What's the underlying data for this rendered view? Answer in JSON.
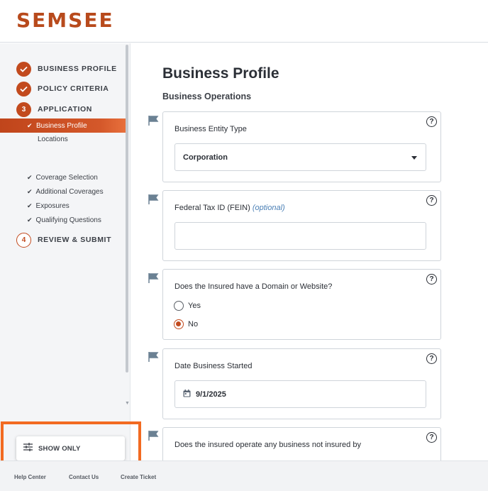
{
  "brand": {
    "logo_text": "SEMSEE",
    "accent": "#c24a1e",
    "highlight": "#f26a21"
  },
  "sidebar": {
    "steps": [
      {
        "label": "BUSINESS PROFILE",
        "status": "complete",
        "icon": "check-icon"
      },
      {
        "label": "POLICY CRITERIA",
        "status": "complete",
        "icon": "check-icon"
      },
      {
        "number": "3",
        "label": "APPLICATION",
        "status": "current"
      },
      {
        "number": "4",
        "label": "REVIEW & SUBMIT",
        "status": "pending"
      }
    ],
    "application_items": [
      {
        "label": "Business Profile",
        "active": true
      },
      {
        "label": "Locations"
      },
      {
        "label": "Coverage Selection",
        "checked": true
      },
      {
        "label": "Additional Coverages",
        "checked": true
      },
      {
        "label": "Exposures",
        "checked": true
      },
      {
        "label": "Qualifying Questions",
        "checked": true
      }
    ],
    "show_only_label": "SHOW ONLY"
  },
  "footer": {
    "links": [
      "Help Center",
      "Contact Us",
      "Create Ticket"
    ]
  },
  "main": {
    "title": "Business Profile",
    "section": "Business Operations",
    "questions": [
      {
        "label": "Business Entity Type",
        "type": "select",
        "value": "Corporation"
      },
      {
        "label": "Federal Tax ID (FEIN)",
        "optional_note": "(optional)",
        "type": "text",
        "value": ""
      },
      {
        "label": "Does the Insured have a Domain or Website?",
        "type": "radio",
        "options": [
          "Yes",
          "No"
        ],
        "selected": "No"
      },
      {
        "label": "Date Business Started",
        "type": "date",
        "value": "9/1/2025"
      },
      {
        "label": "Does the insured operate any business not insured by",
        "type": "radio"
      }
    ],
    "help_glyph": "?"
  }
}
